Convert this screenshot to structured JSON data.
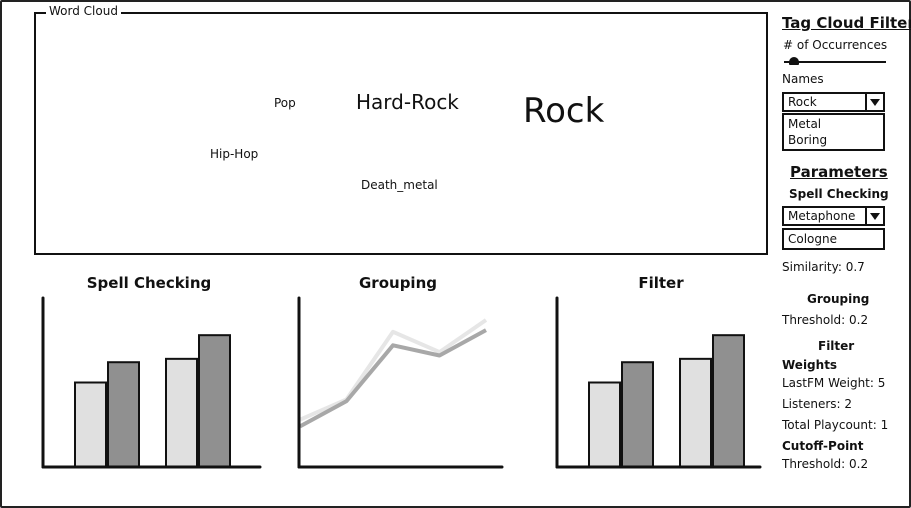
{
  "word_cloud": {
    "legend": "Word Cloud",
    "words": [
      {
        "text": "Pop"
      },
      {
        "text": "Hard-Rock"
      },
      {
        "text": "Rock"
      },
      {
        "text": "Hip-Hop"
      },
      {
        "text": "Death_metal"
      }
    ]
  },
  "charts": {
    "spell_checking": {
      "title": "Spell Checking"
    },
    "grouping": {
      "title": "Grouping"
    },
    "filter": {
      "title": "Filter"
    }
  },
  "chart_data": [
    {
      "type": "bar",
      "title": "Spell Checking",
      "categories": [
        "",
        ""
      ],
      "series": [
        {
          "values": [
            50,
            64
          ],
          "color": "#e0e0e0"
        },
        {
          "values": [
            62,
            78
          ],
          "color": "#909090"
        }
      ],
      "ylim": [
        0,
        100
      ]
    },
    {
      "type": "line",
      "title": "Grouping",
      "x": [
        0,
        1,
        2,
        3,
        4
      ],
      "series": [
        {
          "values": [
            28,
            40,
            80,
            68,
            87
          ],
          "color": "#e6e6e6"
        },
        {
          "values": [
            24,
            39,
            72,
            66,
            81
          ],
          "color": "#a8a8a8"
        }
      ],
      "ylim": [
        0,
        100
      ]
    },
    {
      "type": "bar",
      "title": "Filter",
      "categories": [
        "",
        ""
      ],
      "series": [
        {
          "values": [
            50,
            64
          ],
          "color": "#e0e0e0"
        },
        {
          "values": [
            62,
            78
          ],
          "color": "#909090"
        }
      ],
      "ylim": [
        0,
        100
      ]
    }
  ],
  "sidebar": {
    "tag_cloud_filter": "Tag Cloud Filter",
    "occurrences_label": "# of Occurrences",
    "occurrences_value": 0.05,
    "names_label": "Names",
    "names_selected": "Rock",
    "names_options": [
      "Metal",
      "Boring"
    ],
    "parameters": "Parameters",
    "spell_checking": "Spell Checking",
    "algorithm_selected": "Metaphone",
    "dictionary_value": "Cologne",
    "similarity": "Similarity: 0.7",
    "grouping": "Grouping",
    "grouping_threshold": "Threshold: 0.2",
    "filter": "Filter",
    "weights": "Weights",
    "lastfm_weight": "LastFM Weight: 5",
    "listeners": "Listeners: 2",
    "total_playcount": "Total Playcount: 1",
    "cutoff_point": "Cutoff-Point",
    "cutoff_threshold": "Threshold: 0.2"
  },
  "colors": {
    "border": "#111111",
    "bar_light": "#e0e0e0",
    "bar_dark": "#909090"
  }
}
